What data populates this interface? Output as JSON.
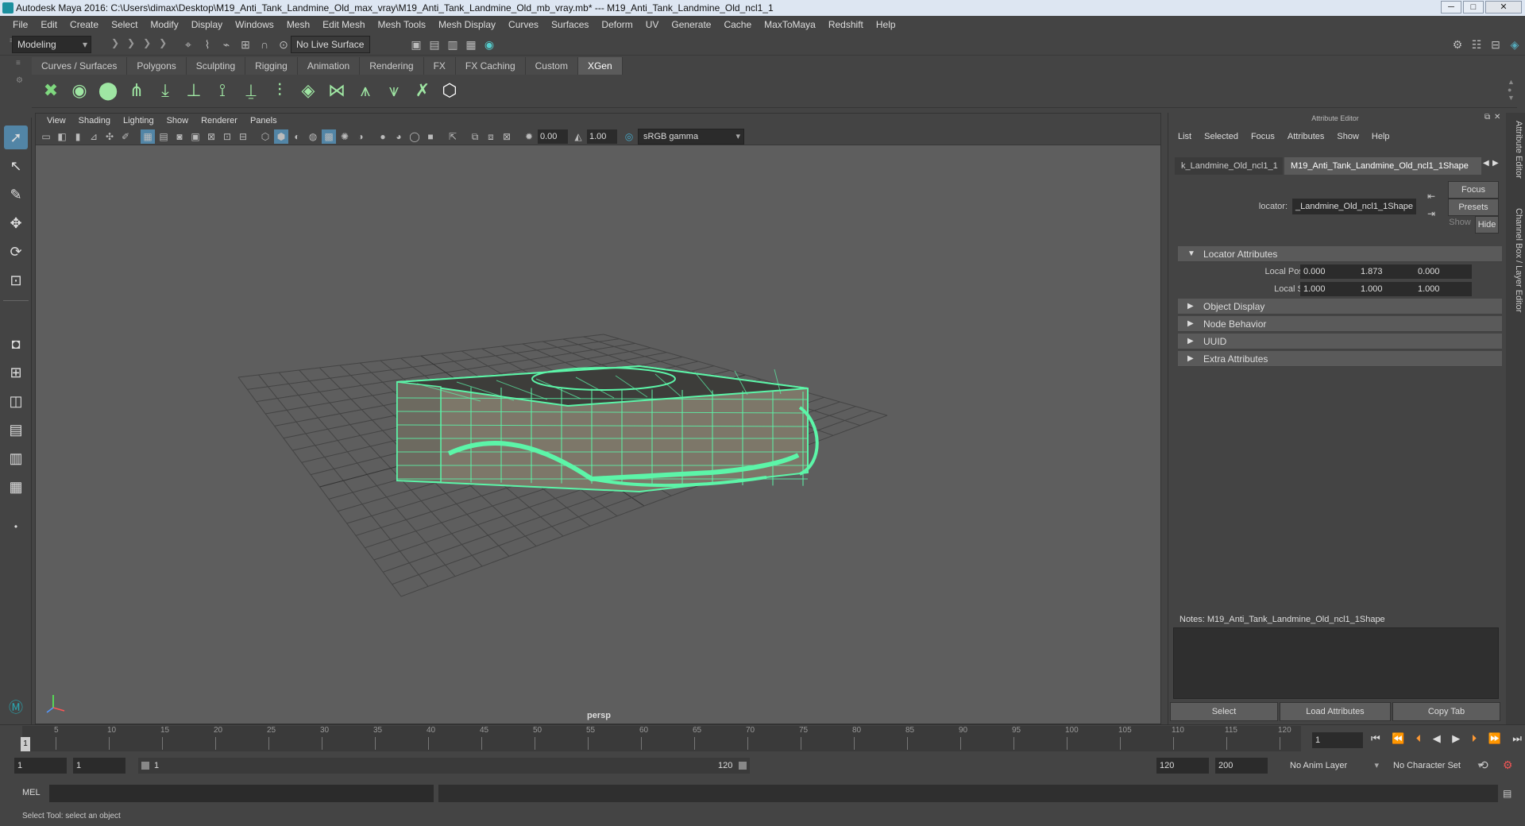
{
  "window": {
    "title": "Autodesk Maya 2016: C:\\Users\\dimax\\Desktop\\M19_Anti_Tank_Landmine_Old_max_vray\\M19_Anti_Tank_Landmine_Old_mb_vray.mb*  ---  M19_Anti_Tank_Landmine_Old_ncl1_1",
    "minimize": "─",
    "maximize": "□",
    "close": "✕"
  },
  "menubar": [
    "File",
    "Edit",
    "Create",
    "Select",
    "Modify",
    "Display",
    "Windows",
    "Mesh",
    "Edit Mesh",
    "Mesh Tools",
    "Mesh Display",
    "Curves",
    "Surfaces",
    "Deform",
    "UV",
    "Generate",
    "Cache",
    "MaxToMaya",
    "Redshift",
    "Help"
  ],
  "statusline": {
    "mode": "Modeling",
    "live_surface": "No Live Surface"
  },
  "shelf": {
    "tabs": [
      "Curves / Surfaces",
      "Polygons",
      "Sculpting",
      "Rigging",
      "Animation",
      "Rendering",
      "FX",
      "FX Caching",
      "Custom",
      "XGen"
    ],
    "active_tab": "XGen"
  },
  "viewport": {
    "menus": [
      "View",
      "Shading",
      "Lighting",
      "Show",
      "Renderer",
      "Panels"
    ],
    "exposure": "0.00",
    "gamma": "1.00",
    "color_space": "sRGB gamma",
    "camera": "persp",
    "wire_color": "#5cf5a8"
  },
  "attribute_editor": {
    "title": "Attribute Editor",
    "menus": [
      "List",
      "Selected",
      "Focus",
      "Attributes",
      "Show",
      "Help"
    ],
    "tabs": [
      "k_Landmine_Old_ncl1_1",
      "M19_Anti_Tank_Landmine_Old_ncl1_1Shape"
    ],
    "node_label": "locator:",
    "node_value": "_Landmine_Old_ncl1_1Shape",
    "focus_btn": "Focus",
    "presets_btn": "Presets",
    "show_btn": "Show",
    "hide_btn": "Hide",
    "sections": {
      "locator": "Locator Attributes",
      "object_display": "Object Display",
      "node_behavior": "Node Behavior",
      "uuid": "UUID",
      "extra": "Extra Attributes"
    },
    "local_position": {
      "label": "Local Position",
      "x": "0.000",
      "y": "1.873",
      "z": "0.000"
    },
    "local_scale": {
      "label": "Local Scale",
      "x": "1.000",
      "y": "1.000",
      "z": "1.000"
    },
    "notes": "Notes:  M19_Anti_Tank_Landmine_Old_ncl1_1Shape",
    "bottom_buttons": {
      "select": "Select",
      "load": "Load Attributes",
      "copy": "Copy Tab"
    }
  },
  "side_tabs": [
    "Attribute Editor",
    "Channel Box / Layer Editor"
  ],
  "timeline": {
    "ticks": [
      "5",
      "10",
      "15",
      "20",
      "25",
      "30",
      "35",
      "40",
      "45",
      "50",
      "55",
      "60",
      "65",
      "70",
      "75",
      "80",
      "85",
      "90",
      "95",
      "100",
      "105",
      "110",
      "115",
      "120"
    ],
    "start_label": "1",
    "current_frame": "1"
  },
  "range": {
    "start": "1",
    "playback_start": "1",
    "slider_start": "1",
    "slider_end": "120",
    "playback_end": "120",
    "end": "200",
    "anim_layer": "No Anim Layer",
    "character_set": "No Character Set"
  },
  "cmdline": {
    "label": "MEL"
  },
  "helpline": "Select Tool: select an object"
}
